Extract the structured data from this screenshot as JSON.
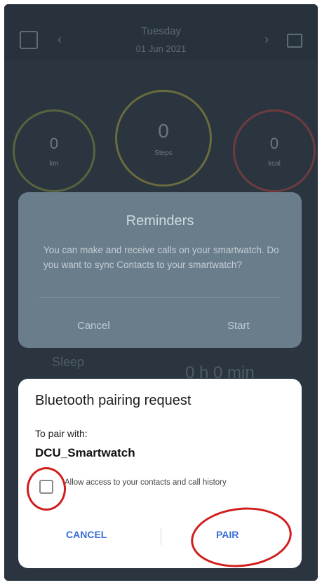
{
  "app": {
    "title": "Tuesday",
    "subtitle": "01 Jun 2021",
    "nav_left": "‹",
    "nav_right": "›",
    "left_icon": "gift-icon",
    "right_icon": "calendar-icon"
  },
  "rings": [
    {
      "value": "0",
      "label": "km"
    },
    {
      "value": "0",
      "label": "Steps"
    },
    {
      "value": "0",
      "label": "kcal"
    }
  ],
  "reminder": {
    "title": "Reminders",
    "message": "You can make and receive calls on your smartwatch. Do you want to sync Contacts to your smartwatch?",
    "cancel_label": "Cancel",
    "start_label": "Start"
  },
  "background": {
    "sleep_label": "Sleep",
    "sleep_value": "0 h 0 min"
  },
  "pairing": {
    "title": "Bluetooth pairing request",
    "to_pair_label": "To pair with:",
    "device_name": "DCU_Smartwatch",
    "allow_text": "Allow access to your contacts and call history",
    "cancel_label": "CANCEL",
    "pair_label": "PAIR"
  },
  "colors": {
    "dialog_button": "#3a6fd8",
    "annotation": "#d11d1d",
    "reminder_bg": "#6a7d8a"
  }
}
